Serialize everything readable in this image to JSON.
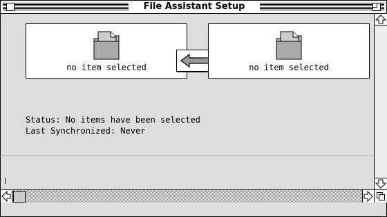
{
  "window": {
    "title": "File Assistant Setup"
  },
  "left_panel": {
    "label": "no item selected",
    "icon": "document-icon"
  },
  "right_panel": {
    "label": "no item selected",
    "icon": "document-icon"
  },
  "swap": {
    "icon": "double-arrow-icon"
  },
  "status": {
    "status_line": "Status: No items have been selected",
    "last_sync_line": "Last Synchronized: Never"
  },
  "scrollbars": {
    "up": "up-arrow-icon",
    "down": "down-arrow-icon",
    "left": "left-arrow-icon",
    "right": "right-arrow-icon"
  }
}
